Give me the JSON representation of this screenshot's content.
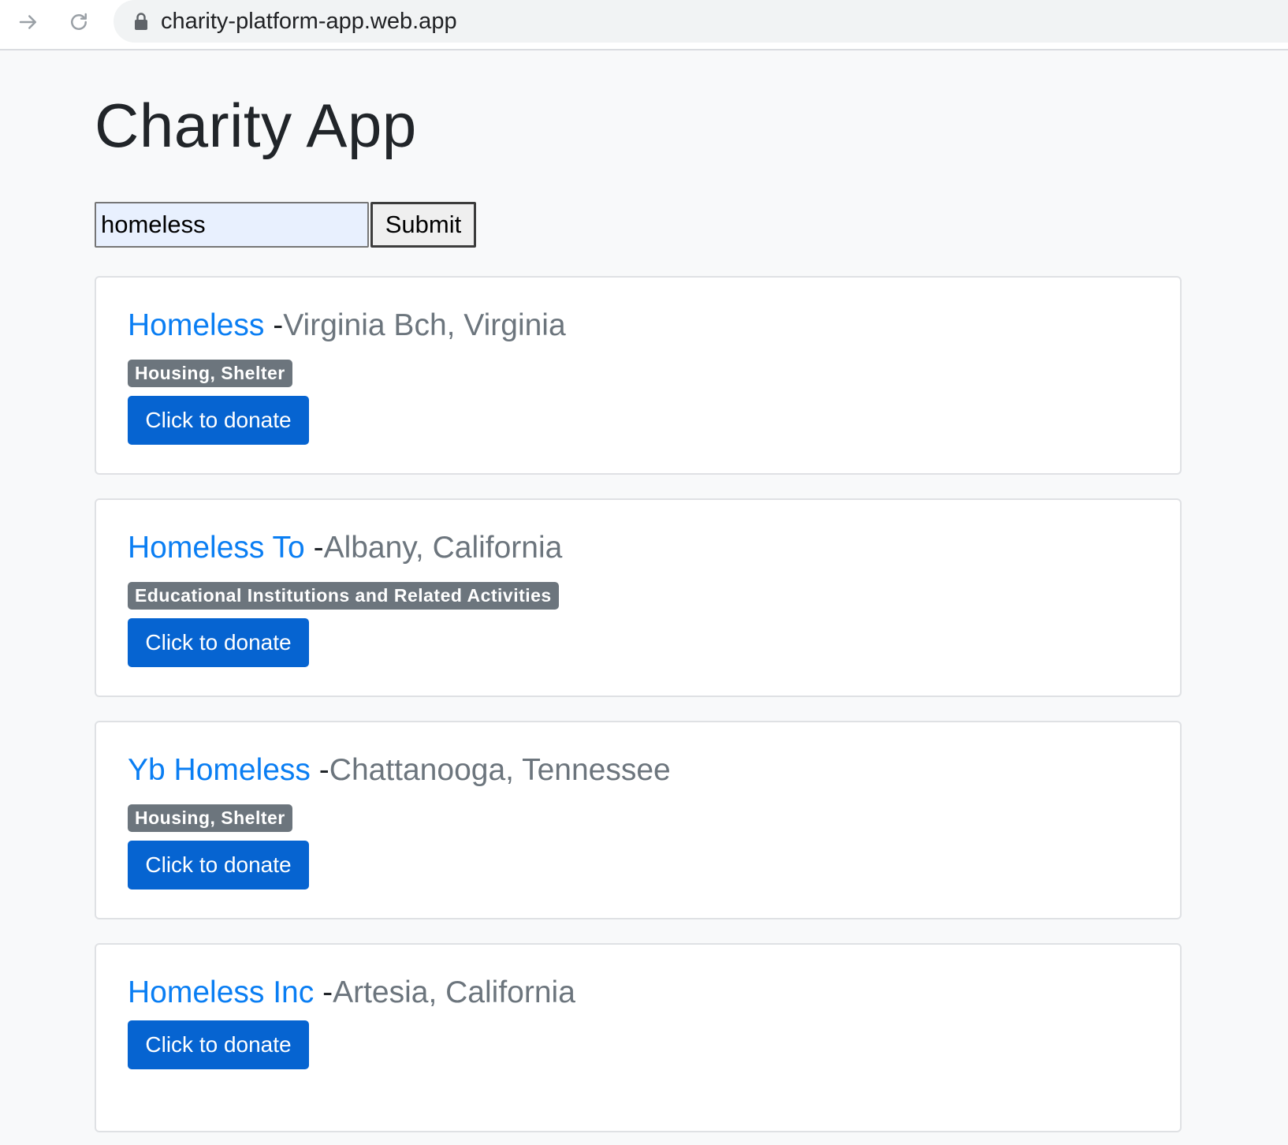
{
  "browser": {
    "url": "charity-platform-app.web.app"
  },
  "page": {
    "title": "Charity App"
  },
  "search": {
    "value": "homeless",
    "submit_label": "Submit"
  },
  "results": [
    {
      "name": "Homeless",
      "separator": "-",
      "location": "Virginia Bch, Virginia",
      "category": "Housing, Shelter",
      "donate_label": "Click to donate"
    },
    {
      "name": "Homeless To",
      "separator": "-",
      "location": "Albany, California",
      "category": "Educational Institutions and Related Activities",
      "donate_label": "Click to donate"
    },
    {
      "name": "Yb Homeless",
      "separator": "-",
      "location": "Chattanooga, Tennessee",
      "category": "Housing, Shelter",
      "donate_label": "Click to donate"
    },
    {
      "name": "Homeless Inc",
      "separator": "-",
      "location": "Artesia, California",
      "category": "",
      "donate_label": "Click to donate"
    }
  ],
  "colors": {
    "link": "#0a7ef3",
    "donate_button": "#0664d1",
    "badge": "#6c757d",
    "location_text": "#6c757d"
  },
  "icons": [
    "forward-arrow-icon",
    "reload-icon",
    "lock-icon"
  ]
}
